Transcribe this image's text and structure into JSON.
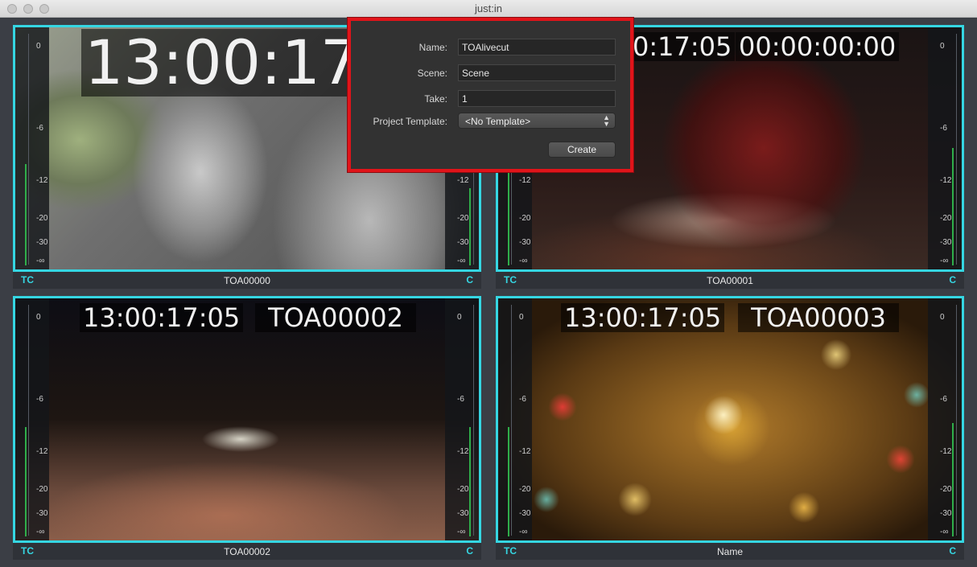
{
  "window": {
    "title": "just:in"
  },
  "meter_scale": [
    "0",
    "-6",
    "-12",
    "-20",
    "-30",
    "-∞"
  ],
  "panels": [
    {
      "timecode": "13:00:17:0",
      "clip": "",
      "footer_left": "TC",
      "footer_name": "TOA00000",
      "footer_right": "C"
    },
    {
      "timecode": "0:17:05",
      "clip": "00:00:00:00",
      "footer_left": "TC",
      "footer_name": "TOA00001",
      "footer_right": "C"
    },
    {
      "timecode": "13:00:17:05",
      "clip": "TOA00002",
      "footer_left": "TC",
      "footer_name": "TOA00002",
      "footer_right": "C"
    },
    {
      "timecode": "13:00:17:05",
      "clip": "TOA00003",
      "footer_left": "TC",
      "footer_name": "Name",
      "footer_right": "C"
    }
  ],
  "dialog": {
    "name_label": "Name:",
    "name_value": "TOAlivecut",
    "scene_label": "Scene:",
    "scene_value": "Scene",
    "take_label": "Take:",
    "take_value": "1",
    "template_label": "Project Template:",
    "template_value": "<No Template>",
    "create_label": "Create"
  },
  "colors": {
    "accent": "#35d6e2",
    "highlight_border": "#e0141a",
    "meter_green": "#2fae4a"
  }
}
